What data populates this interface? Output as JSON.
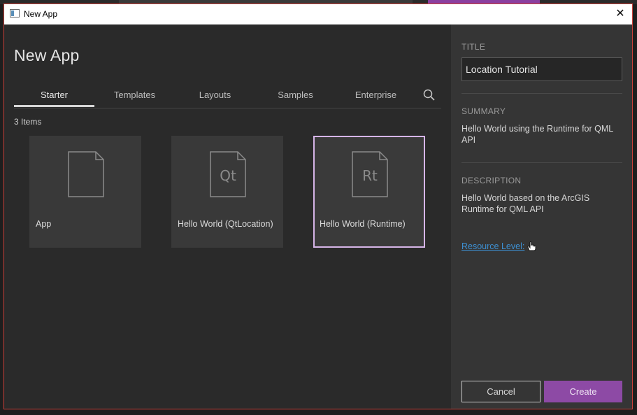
{
  "window": {
    "title": "New App",
    "accent_color": "#8d4aa5",
    "border_color": "#c9403a",
    "close_glyph": "✕"
  },
  "left": {
    "heading": "New App",
    "tabs": [
      {
        "label": "Starter",
        "active": true
      },
      {
        "label": "Templates",
        "active": false
      },
      {
        "label": "Layouts",
        "active": false
      },
      {
        "label": "Samples",
        "active": false
      },
      {
        "label": "Enterprise",
        "active": false
      }
    ],
    "search_icon": "search-icon",
    "item_count": "3 Items",
    "items": [
      {
        "label": "App",
        "glyph": "",
        "selected": false
      },
      {
        "label": "Hello World (QtLocation)",
        "glyph": "Qt",
        "selected": false
      },
      {
        "label": "Hello World (Runtime)",
        "glyph": "Rt",
        "selected": true
      }
    ]
  },
  "right": {
    "title_label": "TITLE",
    "title_value": "Location Tutorial",
    "summary_label": "SUMMARY",
    "summary_text": "Hello World using the Runtime for QML API",
    "description_label": "DESCRIPTION",
    "description_text": "Hello World based on the ArcGIS Runtime for QML API",
    "resource_link": "Resource Level:",
    "cancel_label": "Cancel",
    "create_label": "Create"
  }
}
